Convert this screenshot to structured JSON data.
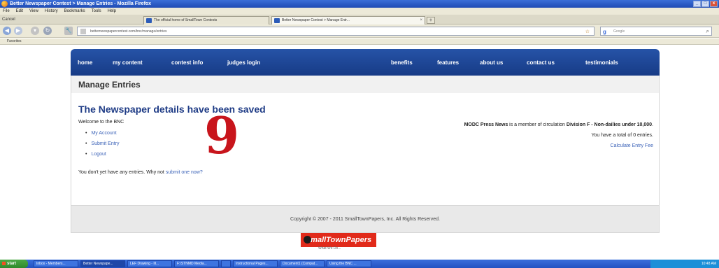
{
  "browser": {
    "window_title": "Better Newspaper Contest > Manage Entries - Mozilla Firefox",
    "menu": [
      "File",
      "Edit",
      "View",
      "History",
      "Bookmarks",
      "Tools",
      "Help"
    ],
    "tab_bar_cancel": "Cancel",
    "tabs": [
      {
        "label": "The official home of SmallTown Contests"
      },
      {
        "label": "Better Newspaper Contest > Manage Entr..."
      }
    ],
    "url": "betternewspapercontest.com/bnc/manage/entries",
    "search_placeholder": "Google",
    "bookmark": "Favorites"
  },
  "site": {
    "nav_left": [
      "home",
      "my content",
      "contest info",
      "judges login"
    ],
    "nav_right": [
      "benefits",
      "features",
      "about us",
      "contact us",
      "testimonials"
    ],
    "page_title": "Manage Entries",
    "headline": "The Newspaper details have been saved",
    "welcome": "Welcome to the BNC",
    "menu_items": [
      "My Account",
      "Submit Entry",
      "Logout"
    ],
    "overlay_number": "9",
    "paper_name": "MODC Press News",
    "member_text": " is a member of circulation ",
    "division": "Division F - Non-dailies under 10,000",
    "entries_total_text": "You have a total of 0 entries.",
    "calc_link": "Calculate Entry Fee",
    "no_entries_text": "You don't yet have any entries. Why not ",
    "submit_link": "submit one now?",
    "copyright": "Copyright © 2007 - 2011 SmallTownPapers, Inc. All Rights Reserved.",
    "logo_text": "SmallTownPapers",
    "logo_tagline": "What We Do..."
  },
  "taskbar": {
    "start": "start",
    "items": [
      "Inbox - Members...",
      "Better Newspape...",
      "LEF Drawing - Ill...",
      "F:\\STNMD Media...",
      "",
      "Instructional Pages...",
      "Document1 (Compat...",
      "Using the BNC ..."
    ],
    "clock": "10:48 AM"
  },
  "colors": {
    "nav_blue": "#1f4593",
    "headline_blue": "#1f3c86",
    "link_blue": "#3c63b8",
    "overlay_red": "#c8151c",
    "logo_red": "#e12a1a"
  }
}
